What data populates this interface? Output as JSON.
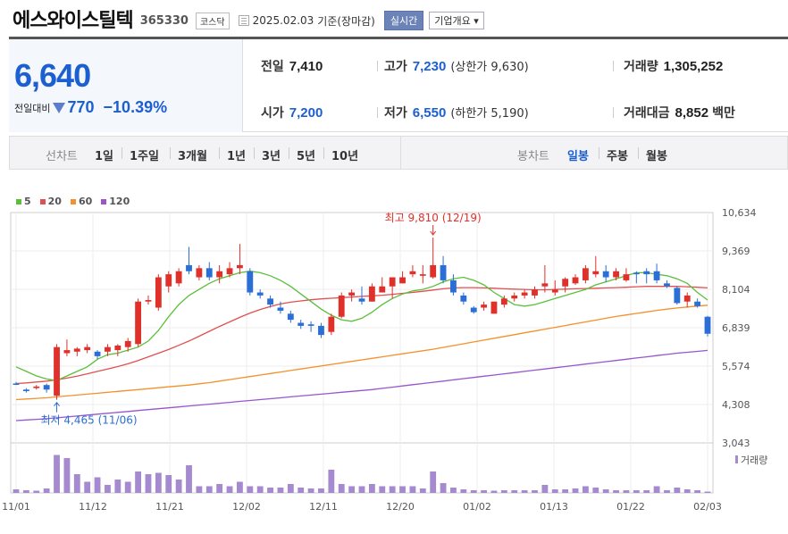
{
  "header": {
    "title": "에스와이스틸텍",
    "code": "365330",
    "market": "코스닥",
    "date": "2025.02.03",
    "basis": "기준(장마감)",
    "realtime_label": "실시간",
    "corp_label": "기업개요"
  },
  "quote": {
    "price": "6,640",
    "diff_label": "전일대비",
    "diff": "770",
    "diff_pct": "−10.39%",
    "prev_label": "전일",
    "prev": "7,410",
    "open_label": "시가",
    "open": "7,200",
    "high_label": "고가",
    "high": "7,230",
    "upper_label": "(상한가 9,630)",
    "low_label": "저가",
    "low": "6,550",
    "lower_label": "(하한가 5,190)",
    "volume_label": "거래량",
    "volume": "1,305,252",
    "amount_label": "거래대금",
    "amount": "8,852",
    "amount_unit": "백만"
  },
  "period": {
    "line_label": "선차트",
    "items": [
      "1일",
      "1주일",
      "3개월",
      "1년",
      "3년",
      "5년",
      "10년"
    ],
    "candle_label": "봉차트",
    "candle_items": [
      "일봉",
      "주봉",
      "월봉"
    ],
    "candle_active": "일봉"
  },
  "colors": {
    "up": "#e0302a",
    "down": "#2b6fd6",
    "ma5": "#5bbf3a",
    "ma20": "#e05050",
    "ma60": "#f5902a",
    "ma120": "#9955cc",
    "volume": "#a58ad0"
  },
  "chart_data": {
    "type": "candlestick",
    "legend": [
      "5",
      "20",
      "60",
      "120"
    ],
    "yticks": [
      "10,634",
      "9,369",
      "8,104",
      "6,839",
      "5,574",
      "4,308",
      "3,043"
    ],
    "ylim": [
      3043,
      10634
    ],
    "xticks": [
      "11/01",
      "11/12",
      "11/21",
      "12/02",
      "12/11",
      "12/20",
      "01/02",
      "01/13",
      "01/22",
      "02/03"
    ],
    "max_annotation": "최고 9,810 (12/19)",
    "min_annotation": "최저 4,465 (11/06)",
    "volume_label": "거래량",
    "candles": [
      [
        5000,
        5050,
        4950,
        4980
      ],
      [
        4800,
        4850,
        4700,
        4750
      ],
      [
        4850,
        4950,
        4800,
        4900
      ],
      [
        4950,
        5000,
        4700,
        4800
      ],
      [
        4600,
        6300,
        4465,
        6200
      ],
      [
        6000,
        6450,
        5900,
        6100
      ],
      [
        6050,
        6200,
        5900,
        6150
      ],
      [
        6100,
        6300,
        6000,
        6200
      ],
      [
        6050,
        6100,
        5800,
        5900
      ],
      [
        6050,
        6300,
        5900,
        6200
      ],
      [
        6100,
        6300,
        5900,
        6250
      ],
      [
        6200,
        6500,
        6050,
        6400
      ],
      [
        6300,
        7800,
        6200,
        7700
      ],
      [
        7700,
        7900,
        7600,
        7750
      ],
      [
        7500,
        8600,
        7400,
        8500
      ],
      [
        8200,
        8700,
        8000,
        8600
      ],
      [
        8300,
        8800,
        8200,
        8700
      ],
      [
        8900,
        9500,
        8600,
        8700
      ],
      [
        8500,
        8900,
        8400,
        8800
      ],
      [
        8800,
        9000,
        8400,
        8500
      ],
      [
        8500,
        8900,
        8300,
        8700
      ],
      [
        8600,
        9000,
        8500,
        8800
      ],
      [
        8800,
        9600,
        8600,
        8900
      ],
      [
        8700,
        8800,
        7900,
        8000
      ],
      [
        8000,
        8100,
        7800,
        7900
      ],
      [
        7800,
        7900,
        7500,
        7600
      ],
      [
        7500,
        7700,
        7300,
        7400
      ],
      [
        7300,
        7400,
        7000,
        7100
      ],
      [
        7000,
        7100,
        6800,
        6900
      ],
      [
        6950,
        7050,
        6700,
        6900
      ],
      [
        6900,
        7000,
        6500,
        6600
      ],
      [
        6700,
        7300,
        6600,
        7200
      ],
      [
        7200,
        8000,
        7150,
        7900
      ],
      [
        7900,
        8100,
        7700,
        8000
      ],
      [
        7800,
        8200,
        7600,
        7700
      ],
      [
        7700,
        8300,
        7700,
        8200
      ],
      [
        8000,
        8500,
        8100,
        8200
      ],
      [
        8200,
        8500,
        7800,
        8500
      ],
      [
        8300,
        8700,
        8300,
        8500
      ],
      [
        8600,
        8900,
        8500,
        8700
      ],
      [
        8550,
        8900,
        8300,
        8600
      ],
      [
        8500,
        9810,
        8450,
        8900
      ],
      [
        8900,
        9200,
        8300,
        8400
      ],
      [
        8400,
        8600,
        7900,
        8000
      ],
      [
        7900,
        8000,
        7600,
        7700
      ],
      [
        7500,
        7550,
        7300,
        7350
      ],
      [
        7500,
        7700,
        7400,
        7600
      ],
      [
        7300,
        7700,
        7300,
        7700
      ],
      [
        7600,
        7900,
        7500,
        7800
      ],
      [
        7800,
        8000,
        7700,
        7900
      ],
      [
        7900,
        8100,
        7800,
        8000
      ],
      [
        7900,
        8200,
        7800,
        8100
      ],
      [
        8200,
        8900,
        8000,
        8300
      ],
      [
        8000,
        8400,
        7900,
        8100
      ],
      [
        8200,
        8500,
        8000,
        8450
      ],
      [
        8300,
        8600,
        8250,
        8500
      ],
      [
        8400,
        8900,
        8300,
        8800
      ],
      [
        8600,
        9200,
        8500,
        8700
      ],
      [
        8700,
        8900,
        8350,
        8500
      ],
      [
        8500,
        8800,
        8400,
        8700
      ],
      [
        8400,
        8800,
        8350,
        8600
      ],
      [
        8650,
        8700,
        8300,
        8600
      ],
      [
        8700,
        8800,
        8300,
        8600
      ],
      [
        8700,
        8950,
        8300,
        8400
      ],
      [
        8300,
        8400,
        8150,
        8200
      ],
      [
        8150,
        8200,
        7600,
        7650
      ],
      [
        7700,
        8000,
        7500,
        7900
      ],
      [
        7700,
        7800,
        7500,
        7550
      ],
      [
        7200,
        7230,
        6550,
        6640
      ]
    ],
    "ma5": [
      5550,
      5400,
      5250,
      5150,
      5100,
      5250,
      5400,
      5550,
      5800,
      5950,
      6000,
      6100,
      6200,
      6400,
      6750,
      7200,
      7600,
      7900,
      8100,
      8300,
      8450,
      8550,
      8650,
      8700,
      8650,
      8550,
      8400,
      8200,
      7950,
      7700,
      7450,
      7250,
      7100,
      7050,
      7150,
      7350,
      7600,
      7800,
      7950,
      8050,
      8100,
      8200,
      8350,
      8450,
      8500,
      8400,
      8250,
      8000,
      7800,
      7600,
      7550,
      7600,
      7700,
      7800,
      7900,
      8000,
      8100,
      8250,
      8350,
      8450,
      8550,
      8650,
      8650,
      8600,
      8550,
      8450,
      8300,
      8000,
      7750
    ],
    "ma20": [
      5000,
      5020,
      5050,
      5080,
      5120,
      5180,
      5240,
      5320,
      5400,
      5480,
      5560,
      5650,
      5760,
      5880,
      6000,
      6120,
      6260,
      6400,
      6560,
      6720,
      6880,
      7030,
      7180,
      7320,
      7440,
      7540,
      7620,
      7680,
      7720,
      7760,
      7790,
      7810,
      7830,
      7850,
      7870,
      7890,
      7910,
      7940,
      7970,
      8000,
      8040,
      8080,
      8120,
      8150,
      8160,
      8160,
      8150,
      8140,
      8120,
      8110,
      8100,
      8090,
      8090,
      8100,
      8110,
      8120,
      8130,
      8140,
      8150,
      8160,
      8170,
      8190,
      8200,
      8200,
      8200,
      8200,
      8190,
      8170,
      8150
    ],
    "ma60": [
      4470,
      4490,
      4510,
      4530,
      4560,
      4590,
      4620,
      4650,
      4680,
      4710,
      4740,
      4770,
      4800,
      4830,
      4860,
      4890,
      4920,
      4950,
      4990,
      5030,
      5080,
      5130,
      5180,
      5230,
      5280,
      5330,
      5380,
      5430,
      5480,
      5530,
      5580,
      5630,
      5680,
      5730,
      5780,
      5830,
      5880,
      5930,
      5980,
      6030,
      6080,
      6130,
      6190,
      6250,
      6310,
      6370,
      6430,
      6490,
      6550,
      6610,
      6670,
      6730,
      6790,
      6850,
      6910,
      6970,
      7030,
      7090,
      7150,
      7210,
      7260,
      7310,
      7360,
      7410,
      7450,
      7490,
      7520,
      7550,
      7580
    ],
    "ma120": [
      3780,
      3800,
      3820,
      3840,
      3870,
      3900,
      3930,
      3960,
      3990,
      4020,
      4050,
      4080,
      4110,
      4140,
      4170,
      4200,
      4230,
      4260,
      4290,
      4320,
      4350,
      4380,
      4410,
      4440,
      4470,
      4500,
      4530,
      4560,
      4590,
      4620,
      4650,
      4680,
      4710,
      4740,
      4770,
      4800,
      4840,
      4880,
      4920,
      4960,
      5000,
      5040,
      5080,
      5120,
      5160,
      5200,
      5240,
      5280,
      5320,
      5360,
      5400,
      5440,
      5480,
      5520,
      5560,
      5600,
      5640,
      5680,
      5720,
      5760,
      5800,
      5840,
      5880,
      5920,
      5960,
      6000,
      6030,
      6060,
      6090
    ],
    "volume": [
      0.08,
      0.06,
      0.05,
      0.1,
      0.85,
      0.78,
      0.42,
      0.25,
      0.35,
      0.18,
      0.3,
      0.25,
      0.48,
      0.42,
      0.45,
      0.4,
      0.3,
      0.62,
      0.15,
      0.15,
      0.2,
      0.15,
      0.25,
      0.15,
      0.15,
      0.12,
      0.12,
      0.2,
      0.12,
      0.1,
      0.1,
      0.52,
      0.2,
      0.15,
      0.15,
      0.2,
      0.15,
      0.15,
      0.15,
      0.15,
      0.1,
      0.48,
      0.22,
      0.12,
      0.08,
      0.06,
      0.06,
      0.05,
      0.06,
      0.06,
      0.06,
      0.06,
      0.18,
      0.08,
      0.08,
      0.1,
      0.15,
      0.12,
      0.08,
      0.06,
      0.06,
      0.06,
      0.06,
      0.15,
      0.06,
      0.12,
      0.08,
      0.06,
      0.03
    ]
  }
}
